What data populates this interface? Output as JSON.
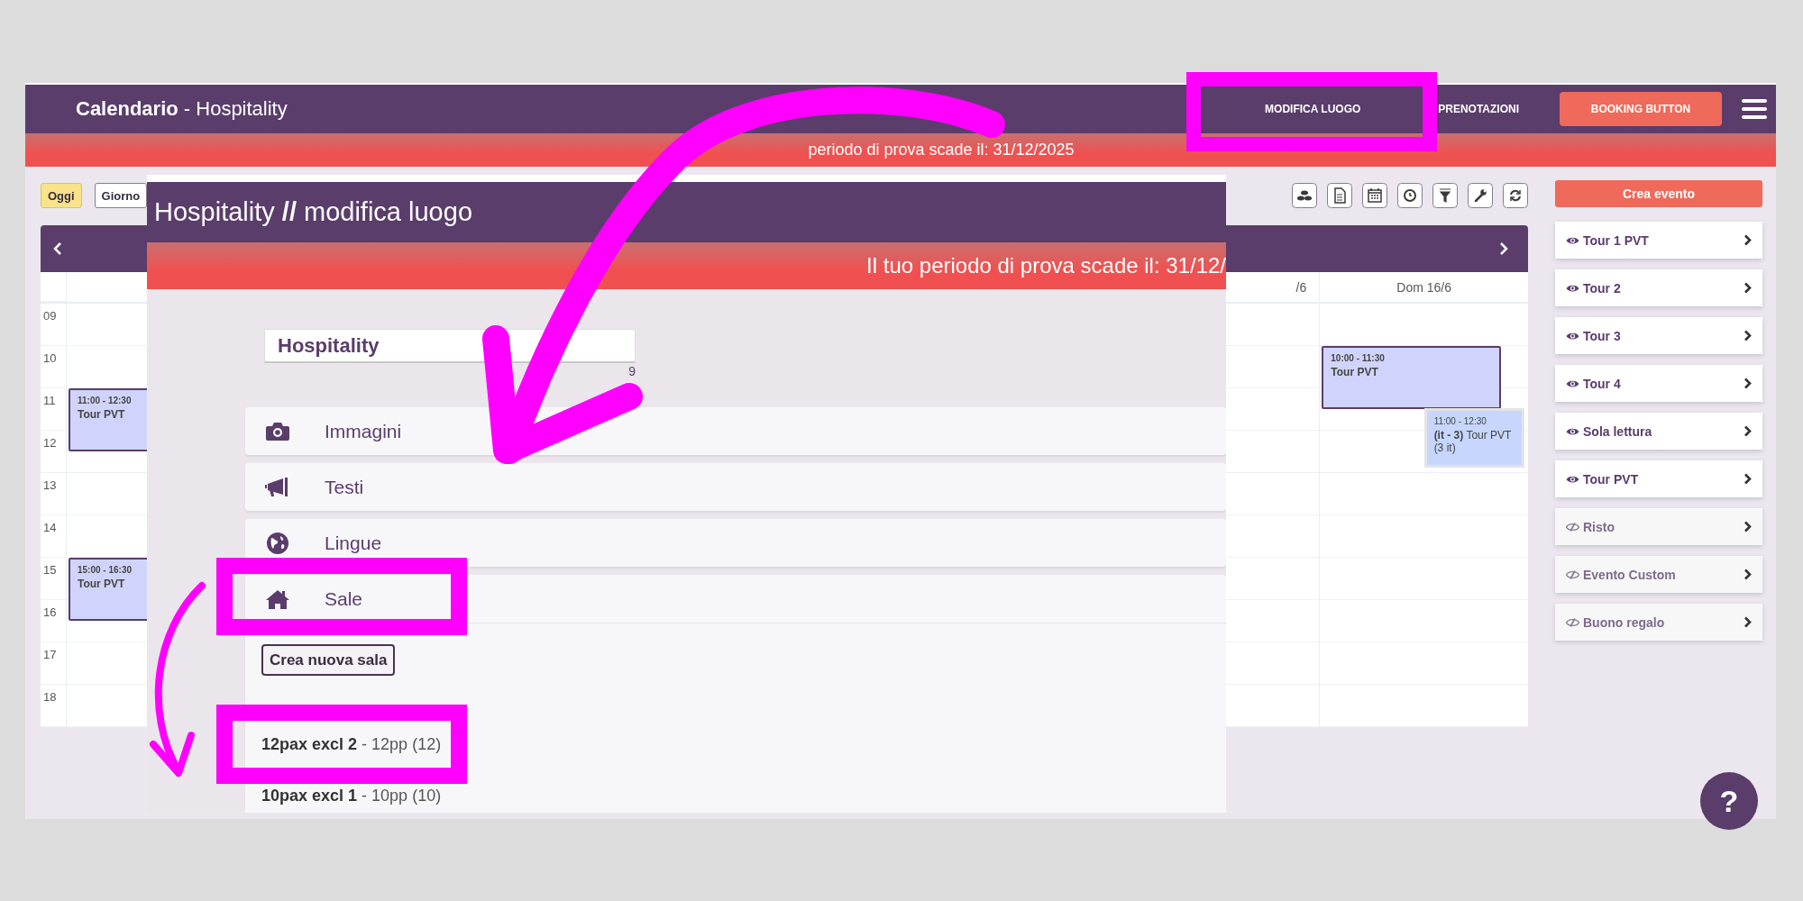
{
  "topbar": {
    "title": "Calendario",
    "subtitle": "- Hospitality",
    "nav": [
      {
        "label": "MODIFICA LUOGO"
      },
      {
        "label": "PRENOTAZIONI"
      }
    ],
    "booking_button": "BOOKING BUTTON"
  },
  "banner": "periodo di prova scade il: 31/12/2025",
  "toolbar": {
    "buttons": [
      {
        "label": "Oggi",
        "selected": true
      },
      {
        "label": "Giorno",
        "selected": false
      }
    ]
  },
  "calendar": {
    "headers": {
      "column_6": "/6",
      "column_7": "Dom 16/6"
    },
    "hours": [
      {
        "label": "09"
      },
      {
        "label": "10",
        "column_7": [
          {
            "kind": "booking",
            "time": "10:00 - 11:30",
            "title": "Tour PVT"
          }
        ]
      },
      {
        "label": "11",
        "column_1": [
          {
            "kind": "booking",
            "time": "11:00 - 12:30",
            "title": "Tour PVT"
          }
        ],
        "column_7": [
          {
            "kind": "group",
            "time": "11:00 - 12:30",
            "title": "**(it - 3)** Tour PVT (3 it)"
          }
        ]
      },
      {
        "label": "12"
      },
      {
        "label": "13"
      },
      {
        "label": "14"
      },
      {
        "label": "15",
        "column_1": [
          {
            "kind": "booking",
            "time": "15:00 - 16:30",
            "title": "Tour PVT"
          }
        ]
      },
      {
        "label": "16"
      },
      {
        "label": "17"
      },
      {
        "label": "18"
      }
    ]
  },
  "sidebar": {
    "create_button": "Crea evento",
    "items": [
      {
        "label": "Tour 1 PVT",
        "visible": true
      },
      {
        "label": "Tour 2",
        "visible": true
      },
      {
        "label": "Tour 3",
        "visible": true
      },
      {
        "label": "Tour 4",
        "visible": true
      },
      {
        "label": "Sola lettura",
        "visible": true
      },
      {
        "label": "Tour PVT",
        "visible": true
      },
      {
        "label": "Risto",
        "visible": false
      },
      {
        "label": "Evento Custom",
        "visible": false
      },
      {
        "label": "Buono regalo",
        "visible": false
      }
    ]
  },
  "modal": {
    "title": "Hospitality **//** modifica luogo",
    "banner": "Il tuo periodo di prova scade il: 31/12/",
    "name_field": {
      "value": "Hospitality",
      "counter": "9"
    },
    "sections": [
      {
        "kind": "images",
        "label": "Immagini",
        "expanded": false
      },
      {
        "kind": "texts",
        "label": "Testi",
        "expanded": false
      },
      {
        "kind": "languages",
        "label": "Lingue",
        "expanded": false
      },
      {
        "kind": "rooms",
        "label": "Sale",
        "expanded": true
      }
    ],
    "create_room_button": "Crea nuova sala",
    "rooms": [
      {
        "name": "12pax excl 2",
        "detail": "- 12pp (12)"
      },
      {
        "name": "10pax excl 1",
        "detail": "- 10pp (10)"
      }
    ]
  },
  "help_button": "?"
}
